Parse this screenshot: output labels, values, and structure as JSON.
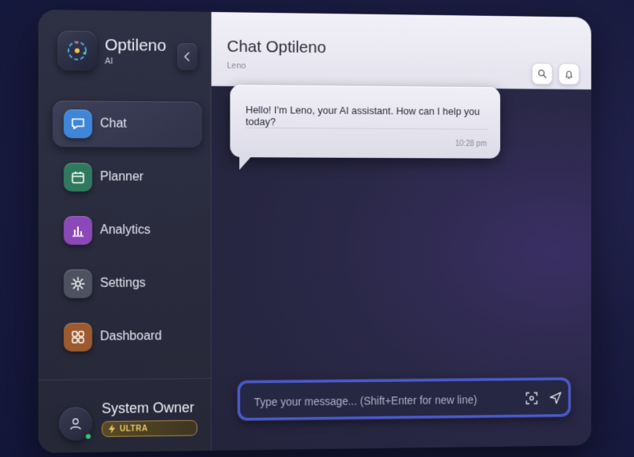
{
  "brand": {
    "name": "Optileno",
    "subtitle": "AI"
  },
  "nav": [
    {
      "label": "Chat",
      "icon": "chat-icon",
      "color": "#3f86d8",
      "active": true
    },
    {
      "label": "Planner",
      "icon": "calendar-icon",
      "color": "#2f7a5e",
      "active": false
    },
    {
      "label": "Analytics",
      "icon": "bar-chart-icon",
      "color": "#8b48b8",
      "active": false
    },
    {
      "label": "Settings",
      "icon": "gear-icon",
      "color": "#4d5160",
      "active": false
    },
    {
      "label": "Dashboard",
      "icon": "grid-icon",
      "color": "#9c5a2e",
      "active": false
    }
  ],
  "user": {
    "name": "System Owner",
    "badge": "ULTRA",
    "status_color": "#36c77a"
  },
  "chat": {
    "title": "Chat Optileno",
    "subtitle": "Leno",
    "messages": [
      {
        "text": "Hello! I'm Leno, your AI assistant. How can I help you today?",
        "time": "10:28 pm"
      }
    ],
    "input_placeholder": "Type your message... (Shift+Enter for new line)"
  },
  "colors": {
    "accent": "#4a5ad0",
    "badge_gold": "#e6c66a"
  }
}
